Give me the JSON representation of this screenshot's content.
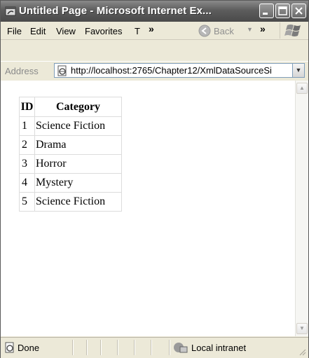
{
  "window": {
    "title": "Untitled Page - Microsoft Internet Ex..."
  },
  "menu": {
    "items": [
      "File",
      "Edit",
      "View",
      "Favorites",
      "T"
    ],
    "more": "»",
    "back_label": "Back"
  },
  "address": {
    "label": "Address",
    "url": "http://localhost:2765/Chapter12/XmlDataSourceSi"
  },
  "table": {
    "headers": [
      "ID",
      "Category"
    ],
    "rows": [
      [
        "1",
        "Science Fiction"
      ],
      [
        "2",
        "Drama"
      ],
      [
        "3",
        "Horror"
      ],
      [
        "4",
        "Mystery"
      ],
      [
        "5",
        "Science Fiction"
      ]
    ]
  },
  "status": {
    "text": "Done",
    "zone": "Local intranet"
  },
  "colors": {
    "titlebar": "#5d5d5d",
    "chrome": "#ece9d8",
    "address_border": "#7f9db9"
  }
}
